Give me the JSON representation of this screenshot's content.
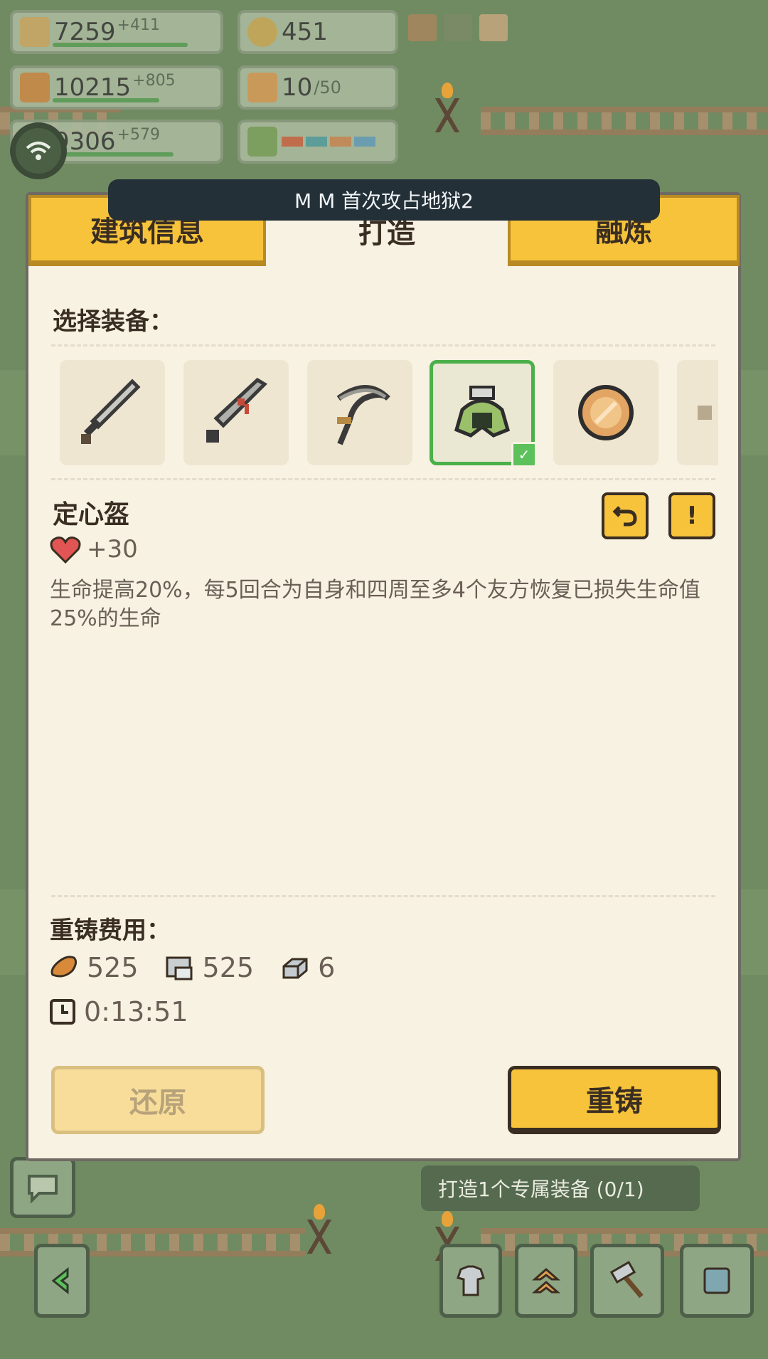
{
  "resources": [
    {
      "name": "wheat-icon",
      "value": "7259",
      "gain": "+411",
      "color": "#c9a867"
    },
    {
      "name": "bread-icon",
      "value": "10215",
      "gain": "+805",
      "color": "#c98a48"
    },
    {
      "name": "stone-icon",
      "value": "9306",
      "gain": "+579",
      "color": "#b8c0c2"
    }
  ],
  "coins": {
    "value": "451"
  },
  "gifts": {
    "value": "10",
    "max": "/50"
  },
  "banner": {
    "text": "M  M 首次攻占地狱2"
  },
  "tabs": {
    "building_info": "建筑信息",
    "forge": "打造",
    "smelt": "融炼"
  },
  "select_label": "选择装备：",
  "equipment": [
    {
      "icon": "sword-icon"
    },
    {
      "icon": "blood-blade-icon"
    },
    {
      "icon": "scythe-icon"
    },
    {
      "icon": "helmet-icon",
      "selected": true
    },
    {
      "icon": "amber-orb-icon"
    },
    {
      "icon": "partial-item-icon"
    }
  ],
  "item": {
    "name": "定心盔",
    "hp_bonus": "+30",
    "description": "生命提高20%，每5回合为自身和四周至多4个友方恢复已损失生命值25%的生命"
  },
  "cost": {
    "label": "重铸费用：",
    "bread": "525",
    "stone": "525",
    "iron": "6",
    "time": "0:13:51"
  },
  "buttons": {
    "restore": "还原",
    "reforge": "重铸"
  },
  "task": {
    "text": "打造1个专属装备 (0/1)"
  },
  "colors": {
    "accent": "#f7c33b",
    "panel": "#f8f2e3",
    "text": "#3a2e22",
    "selected": "#4bb04a"
  }
}
